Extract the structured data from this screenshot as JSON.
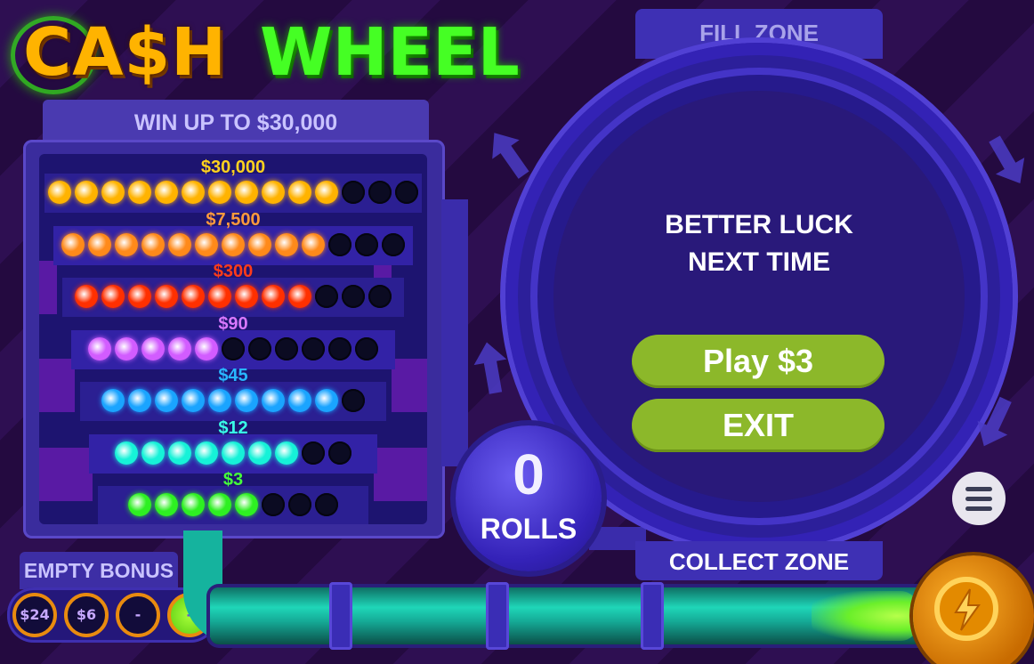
{
  "logo": {
    "cash": "CA$H",
    "wheel": "WHEEL"
  },
  "prize_board": {
    "header": "WIN UP TO $30,000",
    "tiers": [
      {
        "label": "$30,000",
        "color": "#ffd21e",
        "dot_color": "#ffb300",
        "lit": 11,
        "total": 14
      },
      {
        "label": "$7,500",
        "color": "#ff9a3c",
        "dot_color": "#ff8a1a",
        "lit": 10,
        "total": 13
      },
      {
        "label": "$300",
        "color": "#ff3b1a",
        "dot_color": "#ff3000",
        "lit": 9,
        "total": 12
      },
      {
        "label": "$90",
        "color": "#d878ff",
        "dot_color": "#d25cff",
        "lit": 5,
        "total": 11
      },
      {
        "label": "$45",
        "color": "#28b6ff",
        "dot_color": "#1aa4ff",
        "lit": 9,
        "total": 10
      },
      {
        "label": "$12",
        "color": "#39ffe8",
        "dot_color": "#16f2d8",
        "lit": 7,
        "total": 9
      },
      {
        "label": "$3",
        "color": "#45ff3a",
        "dot_color": "#2ef022",
        "lit": 5,
        "total": 8
      }
    ]
  },
  "empty_bonus": {
    "header": "EMPTY BONUS",
    "coins": [
      {
        "label": "$24"
      },
      {
        "label": "$6"
      },
      {
        "label": "-"
      },
      {
        "label": "-",
        "highlighted": true
      }
    ]
  },
  "rolls": {
    "count": "0",
    "label": "ROLLS"
  },
  "wheel": {
    "fill_zone": "FILL ZONE",
    "collect_zone": "COLLECT ZONE",
    "message_line1": "BETTER LUCK",
    "message_line2": "NEXT TIME",
    "play_label": "Play $3",
    "exit_label": "EXIT"
  },
  "colors": {
    "accent_green_button": "#8cb82a",
    "panel_blue": "#3a2c9d",
    "pipe_teal": "#1fd6b8",
    "bolt_orange": "#ff9f1a"
  }
}
